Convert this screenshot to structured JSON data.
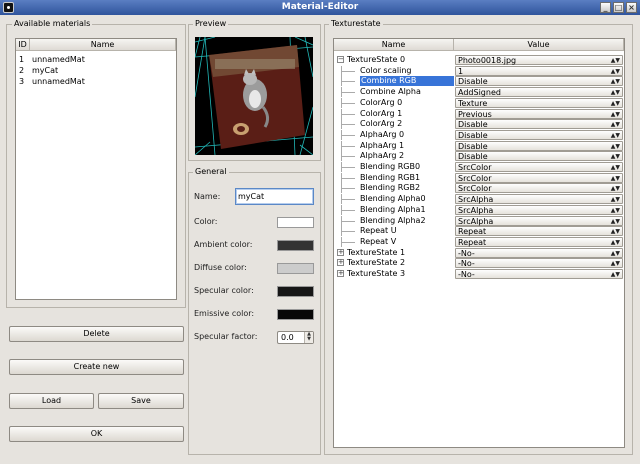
{
  "window": {
    "title": "Material-Editor"
  },
  "materials": {
    "group_label": "Available materials",
    "columns": [
      "ID",
      "Name"
    ],
    "rows": [
      {
        "id": "1",
        "name": "unnamedMat"
      },
      {
        "id": "2",
        "name": "myCat"
      },
      {
        "id": "3",
        "name": "unnamedMat"
      }
    ]
  },
  "buttons": {
    "delete": "Delete",
    "create_new": "Create new",
    "load": "Load",
    "save": "Save",
    "ok": "OK"
  },
  "preview": {
    "group_label": "Preview"
  },
  "general": {
    "group_label": "General",
    "name_label": "Name:",
    "name_value": "myCat",
    "color_label": "Color:",
    "ambient_label": "Ambient color:",
    "diffuse_label": "Diffuse color:",
    "specular_label": "Specular color:",
    "emissive_label": "Emissive color:",
    "specular_factor_label": "Specular factor:",
    "specular_factor_value": "0.0",
    "colors": {
      "color": "#ffffff",
      "ambient": "#333333",
      "diffuse": "#cccccc",
      "specular": "#161616",
      "emissive": "#080808"
    }
  },
  "texturestate": {
    "group_label": "Texturestate",
    "columns": [
      "Name",
      "Value"
    ],
    "items": [
      {
        "name": "TextureState 0",
        "value": "Photo0018.jpg",
        "level": 0,
        "expander": "−"
      },
      {
        "name": "Color scaling",
        "value": "1",
        "level": 1
      },
      {
        "name": "Combine RGB",
        "value": "Disable",
        "level": 1,
        "selected": true
      },
      {
        "name": "Combine Alpha",
        "value": "AddSigned",
        "level": 1
      },
      {
        "name": "ColorArg 0",
        "value": "Texture",
        "level": 1
      },
      {
        "name": "ColorArg 1",
        "value": "Previous",
        "level": 1
      },
      {
        "name": "ColorArg 2",
        "value": "Disable",
        "level": 1
      },
      {
        "name": "AlphaArg 0",
        "value": "Disable",
        "level": 1
      },
      {
        "name": "AlphaArg 1",
        "value": "Disable",
        "level": 1
      },
      {
        "name": "AlphaArg 2",
        "value": "Disable",
        "level": 1
      },
      {
        "name": "Blending RGB0",
        "value": "SrcColor",
        "level": 1
      },
      {
        "name": "Blending RGB1",
        "value": "SrcColor",
        "level": 1
      },
      {
        "name": "Blending RGB2",
        "value": "SrcColor",
        "level": 1
      },
      {
        "name": "Blending Alpha0",
        "value": "SrcAlpha",
        "level": 1
      },
      {
        "name": "Blending Alpha1",
        "value": "SrcAlpha",
        "level": 1
      },
      {
        "name": "Blending Alpha2",
        "value": "SrcAlpha",
        "level": 1
      },
      {
        "name": "Repeat U",
        "value": "Repeat",
        "level": 1
      },
      {
        "name": "Repeat V",
        "value": "Repeat",
        "level": 1
      },
      {
        "name": "TextureState 1",
        "value": "-No-",
        "level": 0,
        "expander": "+"
      },
      {
        "name": "TextureState 2",
        "value": "-No-",
        "level": 0,
        "expander": "+"
      },
      {
        "name": "TextureState 3",
        "value": "-No-",
        "level": 0,
        "expander": "+"
      }
    ]
  },
  "accent": {
    "selection": "#3874d8",
    "grid": "#28d8d8"
  },
  "icons": {
    "app": "app-icon",
    "minimize": "minimize-icon",
    "maximize": "maximize-icon",
    "close": "close-icon",
    "combo": "chevron-updown-icon",
    "spin": "spin-arrows-icon"
  }
}
